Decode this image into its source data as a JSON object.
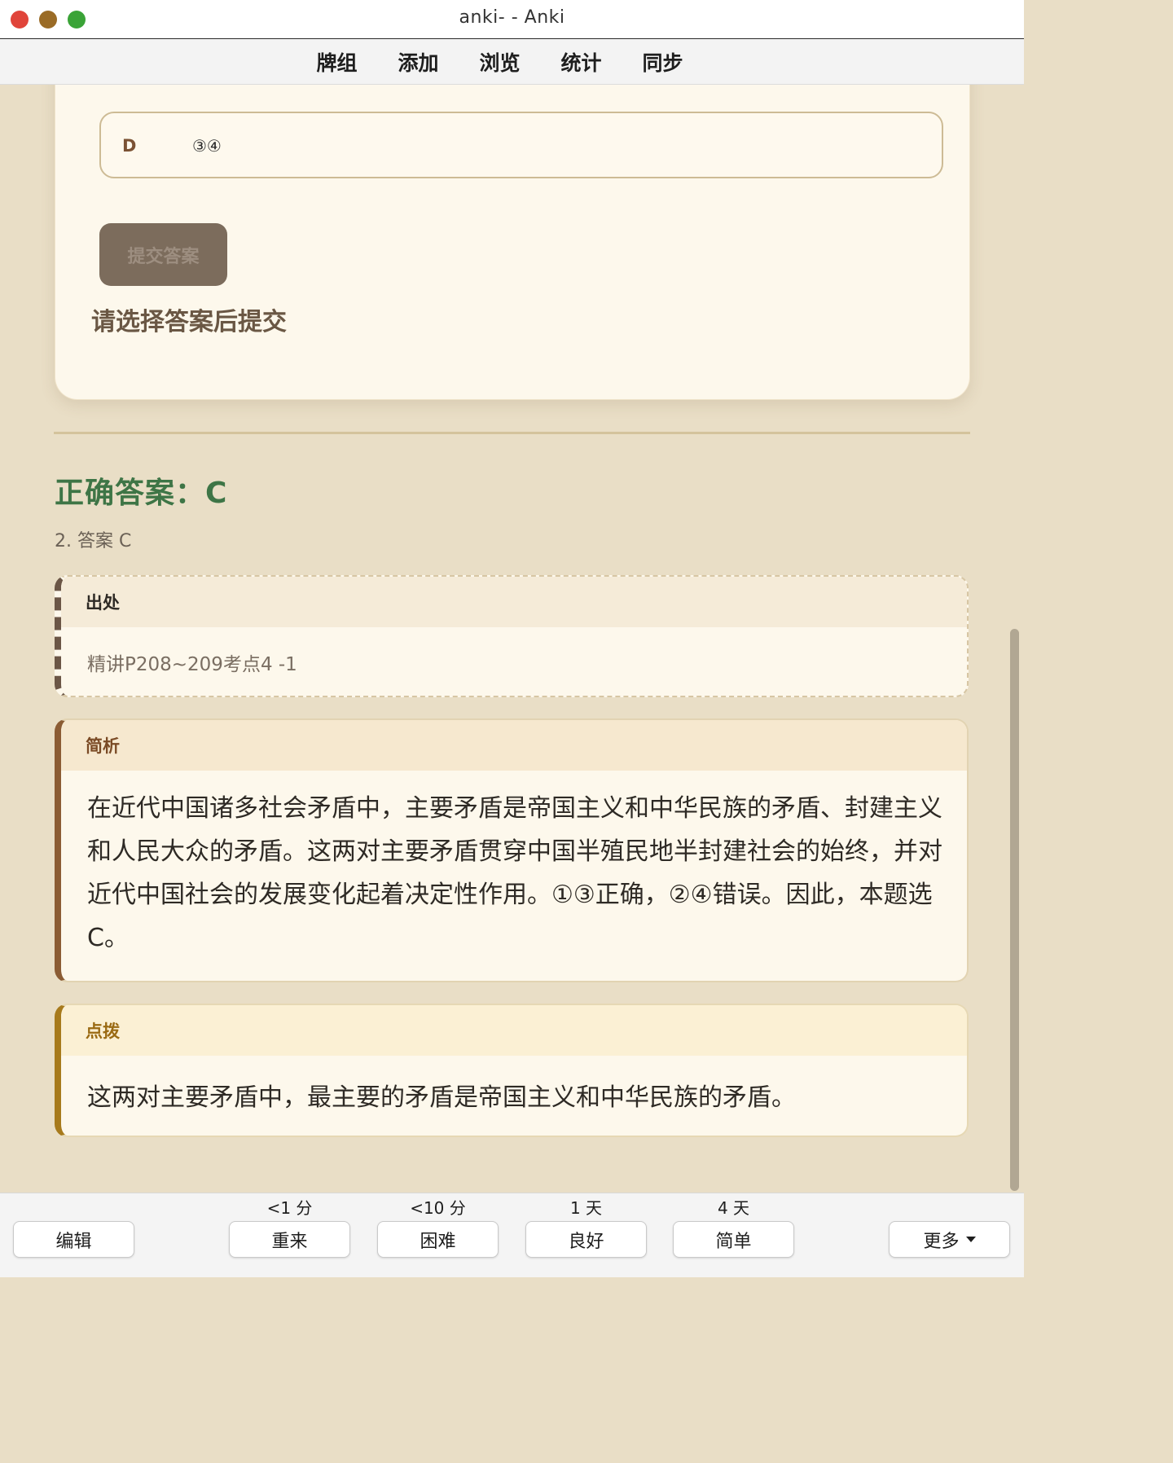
{
  "window": {
    "title": "anki- - Anki"
  },
  "menu": {
    "items": [
      "牌组",
      "添加",
      "浏览",
      "统计",
      "同步"
    ]
  },
  "question": {
    "option_letter": "D",
    "option_text": "③④",
    "submit_label": "提交答案",
    "hint": "请选择答案后提交"
  },
  "answer": {
    "correct": "正确答案：C",
    "note": "2. 答案 C"
  },
  "source": {
    "title": "出处",
    "text": "精讲P208~209考点4 -1"
  },
  "analysis": {
    "title": "简析",
    "text": "在近代中国诸多社会矛盾中，主要矛盾是帝国主义和中华民族的矛盾、封建主义和人民大众的矛盾。这两对主要矛盾贯穿中国半殖民地半封建社会的始终，并对近代中国社会的发展变化起着决定性作用。①③正确，②④错误。因此，本题选C。"
  },
  "tip": {
    "title": "点拨",
    "text": "这两对主要矛盾中，最主要的矛盾是帝国主义和中华民族的矛盾。"
  },
  "bottom": {
    "edit_label": "编辑",
    "more_label": "更多",
    "answers": [
      {
        "interval": "<1 分",
        "label": "重来"
      },
      {
        "interval": "<10 分",
        "label": "困难"
      },
      {
        "interval": "1 天",
        "label": "良好"
      },
      {
        "interval": "4 天",
        "label": "简单"
      }
    ]
  }
}
